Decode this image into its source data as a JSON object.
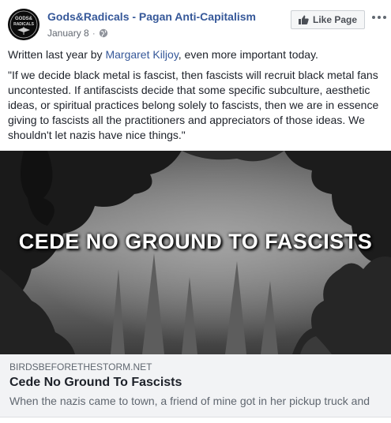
{
  "header": {
    "page_name": "Gods&Radicals - Pagan Anti-Capitalism",
    "date": "January 8",
    "separator": "·",
    "privacy_icon": "globe-icon",
    "like_button": "Like Page",
    "like_icon": "thumbs-up-icon",
    "more_icon": "more-icon",
    "avatar_text_top": "GODS&",
    "avatar_text_bottom": "RADICALS"
  },
  "post": {
    "intro_before": "Written last year by ",
    "intro_link": "Margaret Kiljoy",
    "intro_after": ", even more important today.",
    "quote": "\"If we decide black metal is fascist, then fascists will recruit black metal fans uncontested. If antifascists decide that some specific subculture, aesthetic ideas, or spiritual practices belong solely to fascists, then we are in essence giving to fascists all the practitioners and appreciators of those ideas. We shouldn't let nazis have nice things.\""
  },
  "image": {
    "headline": "CEDE NO GROUND TO FASCISTS"
  },
  "preview": {
    "domain": "BIRDSBEFORETHESTORM.NET",
    "title": "Cede No Ground To Fascists",
    "description": "When the nazis came to town, a friend of mine got in her pickup truck and"
  },
  "colors": {
    "link": "#365899",
    "text": "#1d2129",
    "muted": "#606770",
    "preview_bg": "#f2f3f5"
  }
}
